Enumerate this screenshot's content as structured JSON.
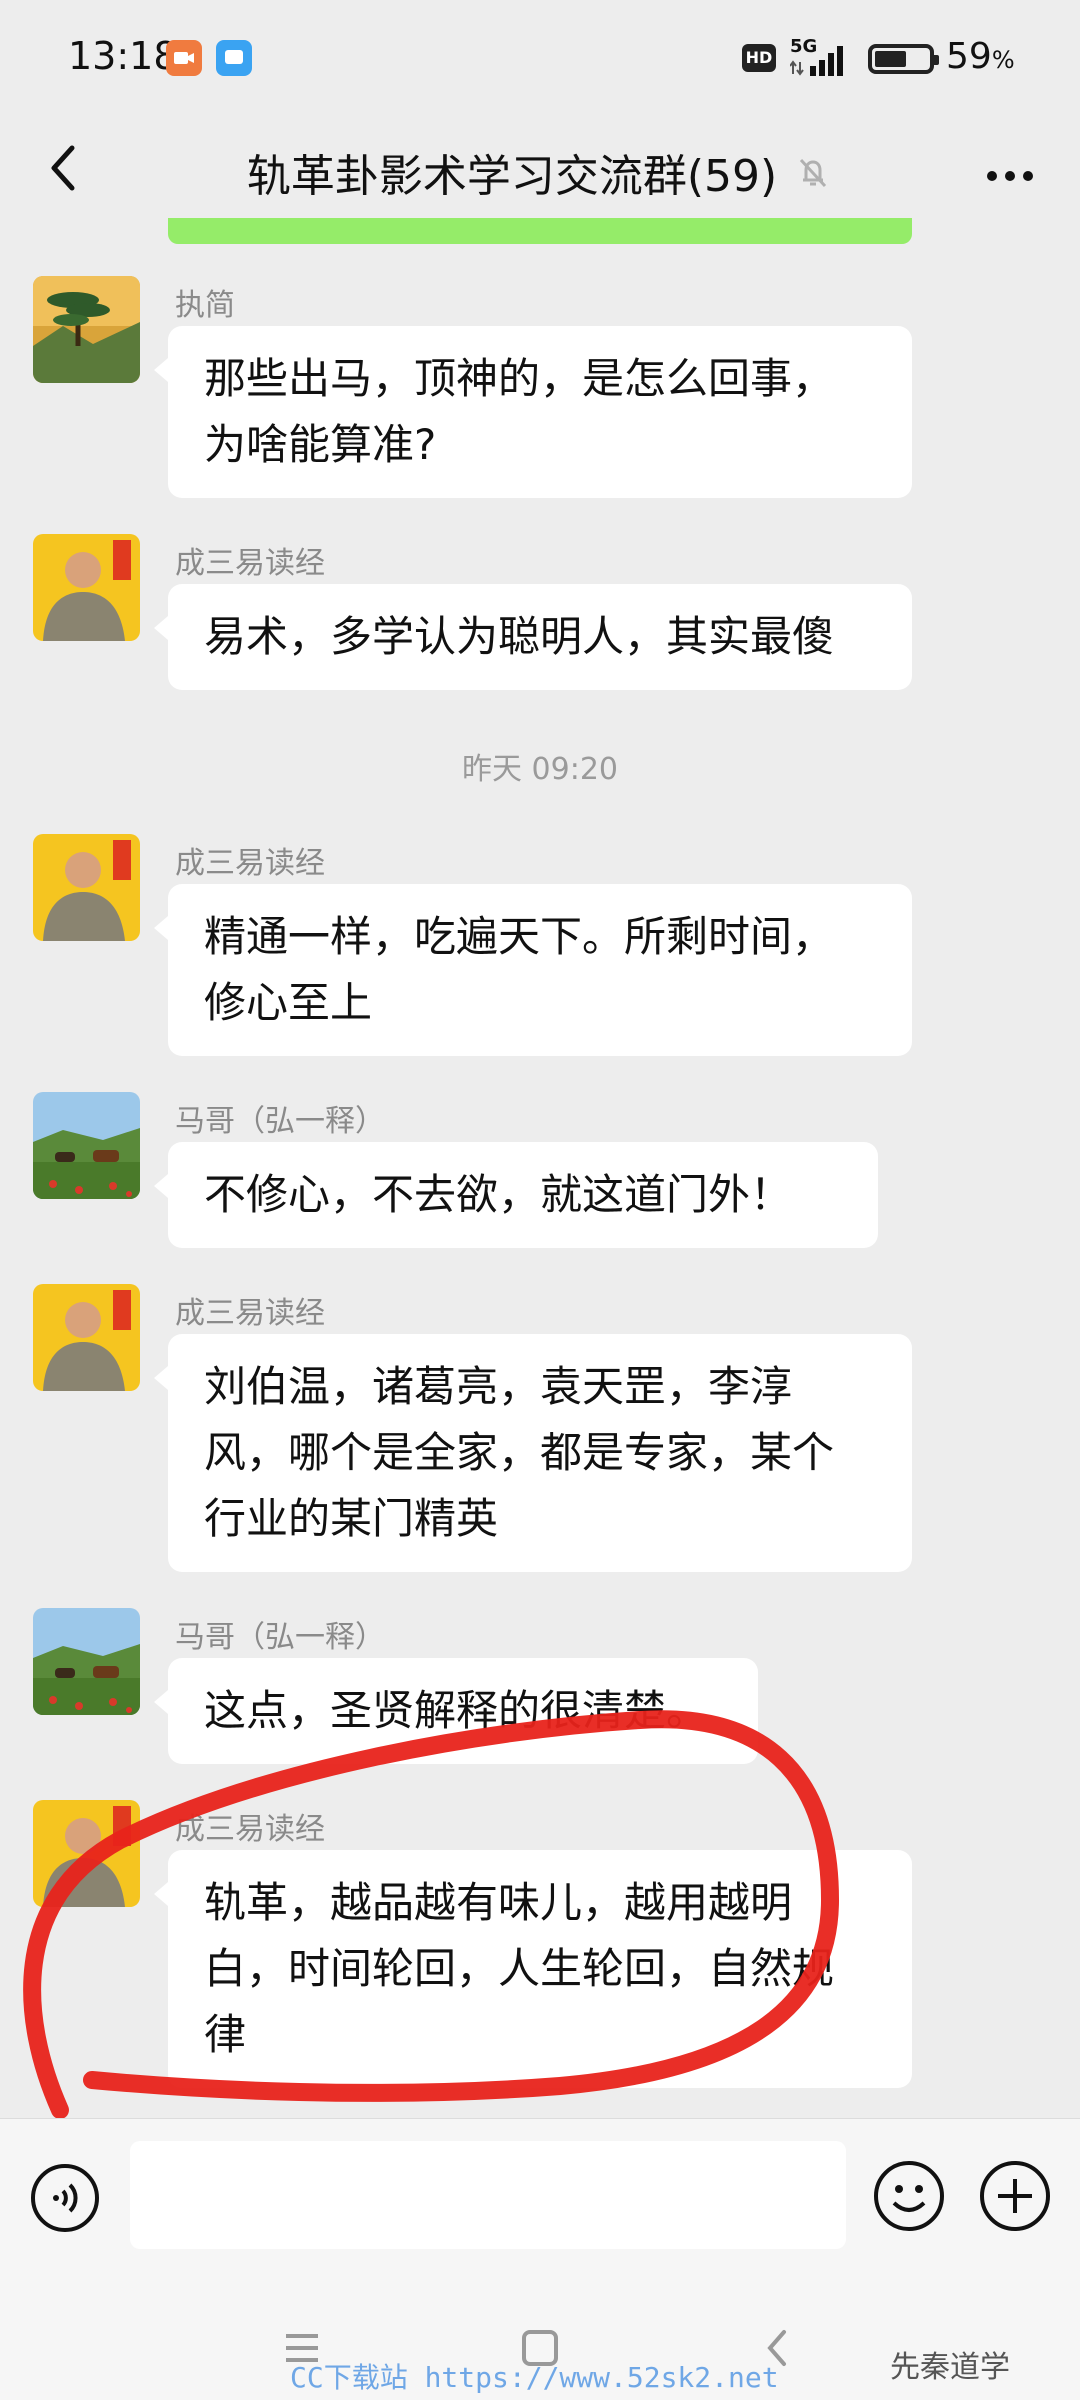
{
  "status_bar": {
    "time": "13:18",
    "hd": "HD",
    "network": "5G",
    "battery_percent_value": "59",
    "battery_percent_sign": "%",
    "battery_level": 0.59
  },
  "header": {
    "title": "轨革卦影术学习交流群(59)",
    "muted": true
  },
  "messages": [
    {
      "sender": "执简",
      "lines": [
        "那些出马，顶神的，是怎么回事，",
        "为啥能算准?"
      ],
      "avatar": "landscape-pine"
    },
    {
      "sender": "成三易读经",
      "lines": [
        "易术，多学认为聪明人，其实最傻"
      ],
      "avatar": "man-portrait"
    },
    {
      "sender": "成三易读经",
      "lines": [
        "精通一样，吃遍天下。所剩时间，",
        "修心至上"
      ],
      "avatar": "man-portrait"
    },
    {
      "sender": "马哥（弘一释）",
      "lines": [
        "不修心，不去欲，就这道门外！"
      ],
      "avatar": "horses-meadow"
    },
    {
      "sender": "成三易读经",
      "lines": [
        "刘伯温，诸葛亮，袁天罡，李淳",
        "风，哪个是全家，都是专家，某个",
        "行业的某门精英"
      ],
      "avatar": "man-portrait"
    },
    {
      "sender": "马哥（弘一释）",
      "lines": [
        "这点，圣贤解释的很清楚。"
      ],
      "avatar": "horses-meadow"
    },
    {
      "sender": "成三易读经",
      "lines": [
        "轨革，越品越有味儿，越用越明",
        "白，时间轮回，人生轮回，自然规",
        "律"
      ],
      "avatar": "man-portrait"
    }
  ],
  "time_divider": "昨天 09:20",
  "input": {
    "placeholder": ""
  },
  "watermark": {
    "url": "CC下载站 https://www.52sk2.net",
    "brand": "先秦道学"
  },
  "colors": {
    "background": "#ededed",
    "bubble": "#ffffff",
    "accent_green": "#95ec69",
    "annotation_red": "#e8231b"
  }
}
